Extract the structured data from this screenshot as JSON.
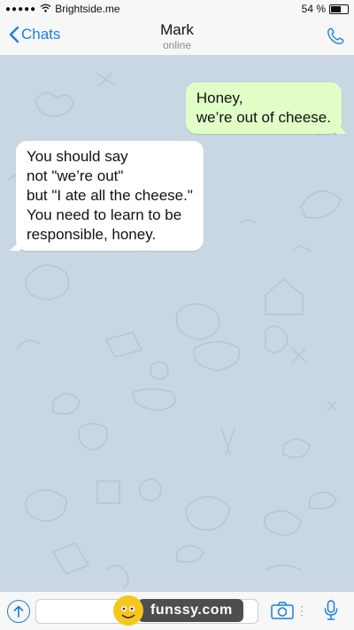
{
  "status_bar": {
    "carrier": "Brightside.me",
    "battery": "54 %",
    "battery_level": 0.54
  },
  "header": {
    "back_label": "Chats",
    "title": "Mark",
    "subtitle": "online"
  },
  "messages": [
    {
      "direction": "outgoing",
      "text": "Honey,\nwe’re out of cheese."
    },
    {
      "direction": "incoming",
      "text": "You should say\nnot \"we’re out\"\nbut \"I ate all the cheese.\"\nYou need to learn to be\nresponsible, honey."
    }
  ],
  "composer": {
    "placeholder": ""
  },
  "watermark": {
    "text": "funssy.com"
  },
  "colors": {
    "accent": "#1a7fe0",
    "outgoing_bubble": "#e1fec6",
    "incoming_bubble": "#ffffff",
    "chat_background": "#c9d6e3"
  }
}
